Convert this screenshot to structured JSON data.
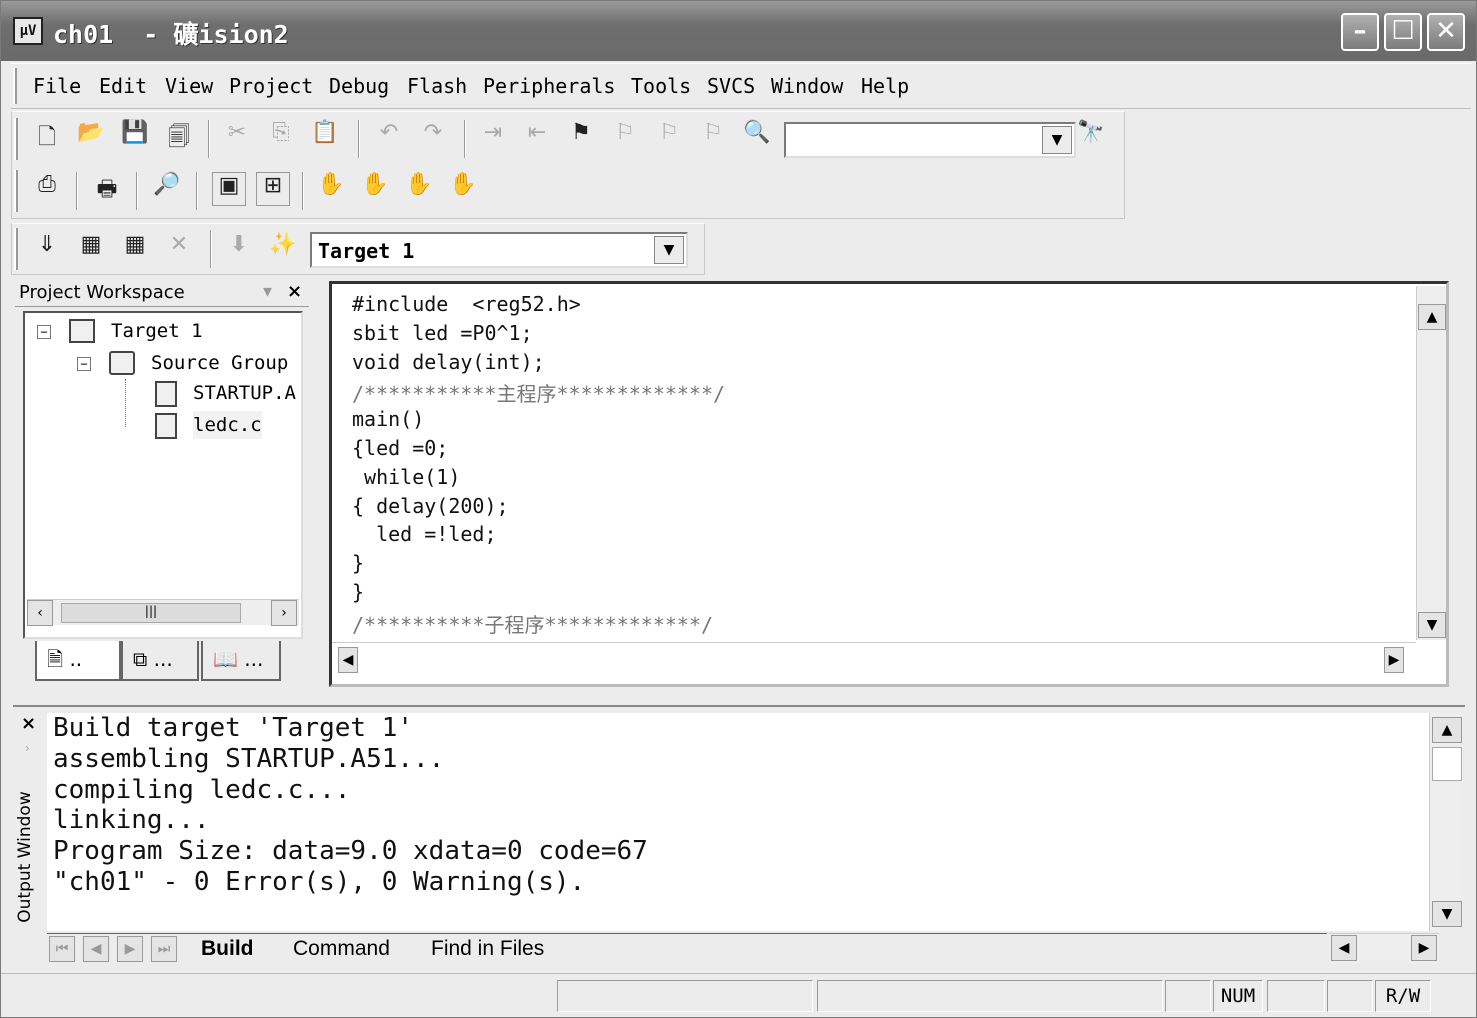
{
  "window": {
    "title": "ch01  - 礦ision2",
    "app_icon": "uv-app-icon",
    "controls": {
      "minimize": "—",
      "maximize": "☐",
      "close": "✕"
    }
  },
  "menubar": {
    "items": [
      "File",
      "Edit",
      "View",
      "Project",
      "Debug",
      "Flash",
      "Peripherals",
      "Tools",
      "SVCS",
      "Window",
      "Help"
    ]
  },
  "toolbar": {
    "find_combo_value": "",
    "target_combo_value": "Target 1"
  },
  "workspace": {
    "title": "Project Workspace",
    "tree": {
      "target": "Target 1",
      "group": "Source Group",
      "files": [
        "STARTUP.A",
        "ledc.c"
      ]
    },
    "tabs": [
      "..",
      "...",
      "..."
    ]
  },
  "editor": {
    "lines": [
      {
        "text": "#include  <reg52.h>",
        "comment": false
      },
      {
        "text": "sbit led =P0^1;",
        "comment": false
      },
      {
        "text": "void delay(int);",
        "comment": false
      },
      {
        "text": "/***********主程序*************/",
        "comment": true
      },
      {
        "text": "main()",
        "comment": false
      },
      {
        "text": "{led =0;",
        "comment": false
      },
      {
        "text": " while(1)",
        "comment": false
      },
      {
        "text": "{ delay(200);",
        "comment": false
      },
      {
        "text": "  led =!led;",
        "comment": false
      },
      {
        "text": "}",
        "comment": false
      },
      {
        "text": "}",
        "comment": false
      },
      {
        "text": "/**********子程序*************/",
        "comment": true
      }
    ]
  },
  "output": {
    "side_label": "Output Window",
    "lines": [
      "Build target 'Target 1'",
      "assembling STARTUP.A51...",
      "compiling ledc.c...",
      "linking...",
      "Program Size: data=9.0 xdata=0 code=67",
      "\"ch01\" - 0 Error(s), 0 Warning(s)."
    ],
    "tabs": [
      "Build",
      "Command",
      "Find in Files"
    ]
  },
  "statusbar": {
    "num": "NUM",
    "rw": "R/W"
  }
}
